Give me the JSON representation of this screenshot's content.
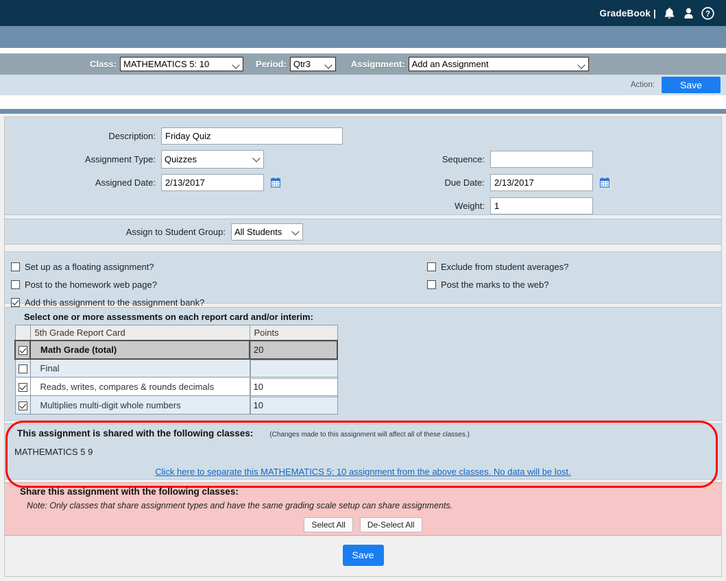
{
  "header": {
    "brand": "GradeBook |",
    "icons": [
      "bell-icon",
      "user-icon",
      "help-icon"
    ]
  },
  "selector_bar": {
    "class_label": "Class:",
    "class_value": "MATHEMATICS 5: 10",
    "period_label": "Period:",
    "period_value": "Qtr3",
    "assignment_label": "Assignment:",
    "assignment_value": "Add an Assignment"
  },
  "action_bar": {
    "label": "Action:",
    "save_label": "Save"
  },
  "form": {
    "description_label": "Description:",
    "description_value": "Friday Quiz",
    "type_label": "Assignment Type:",
    "type_value": "Quizzes",
    "assigned_date_label": "Assigned Date:",
    "assigned_date_value": "2/13/2017",
    "sequence_label": "Sequence:",
    "sequence_value": "",
    "due_date_label": "Due Date:",
    "due_date_value": "2/13/2017",
    "weight_label": "Weight:",
    "weight_value": "1",
    "group_label": "Assign to Student Group:",
    "group_value": "All Students"
  },
  "options": {
    "left": [
      {
        "label": "Set up as a floating assignment?",
        "checked": false
      },
      {
        "label": "Post to the homework web page?",
        "checked": false
      },
      {
        "label": "Add this assignment to the assignment bank?",
        "checked": true
      }
    ],
    "right": [
      {
        "label": "Exclude from student averages?",
        "checked": false
      },
      {
        "label": "Post the marks to the web?",
        "checked": false
      }
    ]
  },
  "assessments": {
    "title": "Select one or more assessments on each report card and/or interim:",
    "columns": [
      "",
      "5th Grade Report Card",
      "Points"
    ],
    "rows": [
      {
        "checked": true,
        "name": "Math Grade (total)",
        "points": "20",
        "style": "total"
      },
      {
        "checked": false,
        "name": "Final",
        "points": "",
        "style": "alt"
      },
      {
        "checked": true,
        "name": "Reads, writes, compares & rounds decimals",
        "points": "10",
        "style": "plain"
      },
      {
        "checked": true,
        "name": "Multiplies multi-digit whole numbers",
        "points": "10",
        "style": "alt"
      }
    ]
  },
  "shared": {
    "title": "This assignment is shared with the following classes:",
    "note": "(Changes made to this assignment will affect all of these classes.)",
    "classes": [
      "MATHEMATICS 5 9"
    ],
    "separate_link": "Click here to separate this MATHEMATICS 5: 10 assignment from the above classes. No data will be lost.",
    "highlight_color": "#ff0000"
  },
  "share_panel": {
    "title": "Share this assignment with the following classes:",
    "note": "Note: Only classes that share assignment types and have the same grading scale setup can share assignments.",
    "select_all": "Select All",
    "deselect_all": "De-Select All",
    "background_color": "#f7c6c6"
  },
  "footer": {
    "save_label": "Save"
  }
}
